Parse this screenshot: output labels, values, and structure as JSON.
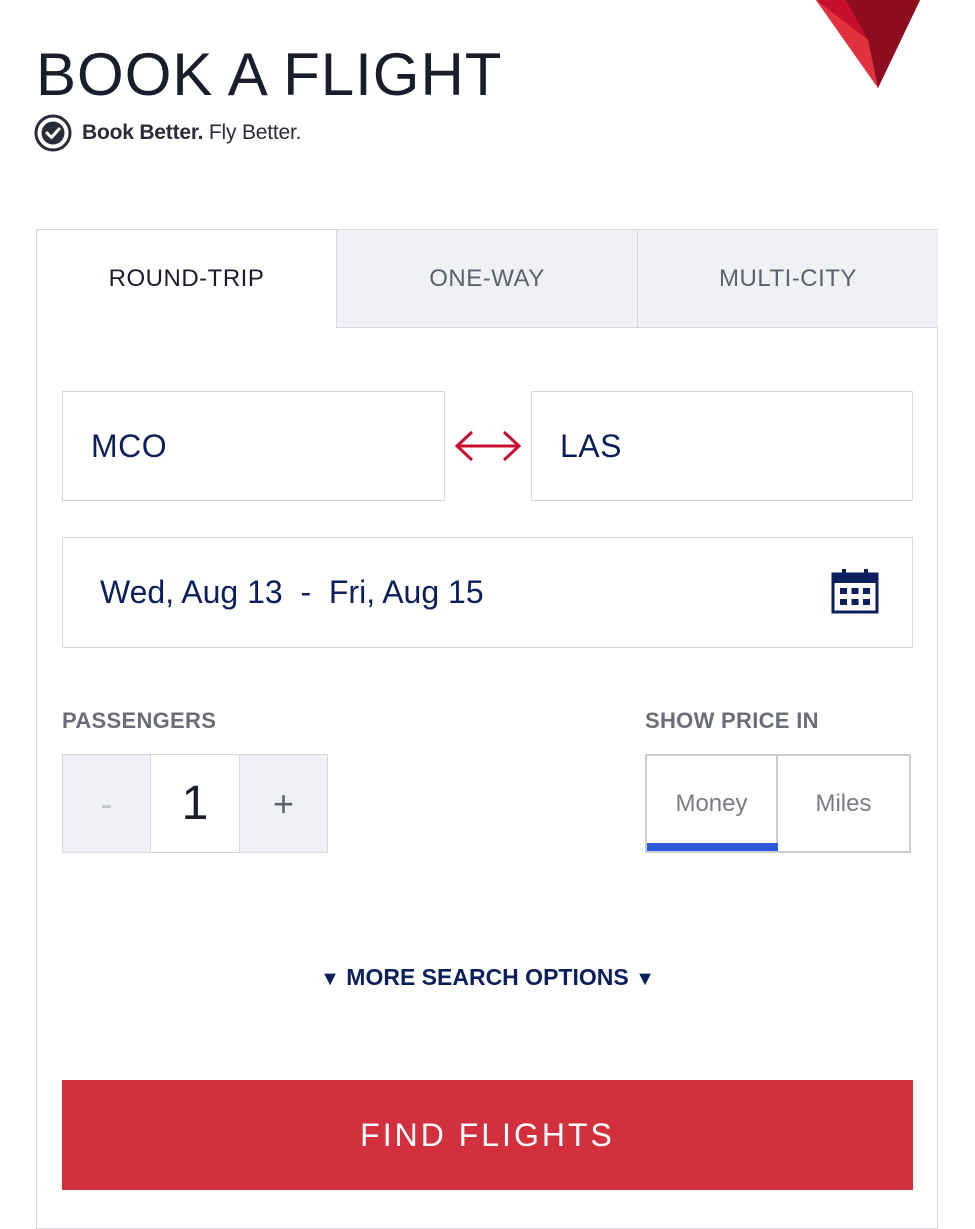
{
  "header": {
    "title": "BOOK A FLIGHT",
    "tagline_bold": "Book Better.",
    "tagline_rest": " Fly Better."
  },
  "tabs": [
    {
      "label": "ROUND-TRIP",
      "active": true
    },
    {
      "label": "ONE-WAY",
      "active": false
    },
    {
      "label": "MULTI-CITY",
      "active": false
    }
  ],
  "route": {
    "from": "MCO",
    "to": "LAS"
  },
  "dates": {
    "display": "Wed, Aug 13  -  Fri, Aug 15"
  },
  "passengers": {
    "label": "PASSENGERS",
    "minus": "-",
    "count": "1",
    "plus": "+"
  },
  "price": {
    "label": "SHOW PRICE IN",
    "options": [
      "Money",
      "Miles"
    ],
    "selected": "Money"
  },
  "more_options": "MORE SEARCH OPTIONS",
  "find_button": "FIND FLIGHTS",
  "colors": {
    "brand_red": "#d2303d",
    "navy": "#0b1f5c",
    "selected_underline": "#2f58d8",
    "tab_inactive_bg": "#eff1f5"
  },
  "icons": [
    "delta-logo-icon",
    "badge-check-icon",
    "swap-arrows-icon",
    "calendar-icon",
    "triangle-down-icon"
  ]
}
